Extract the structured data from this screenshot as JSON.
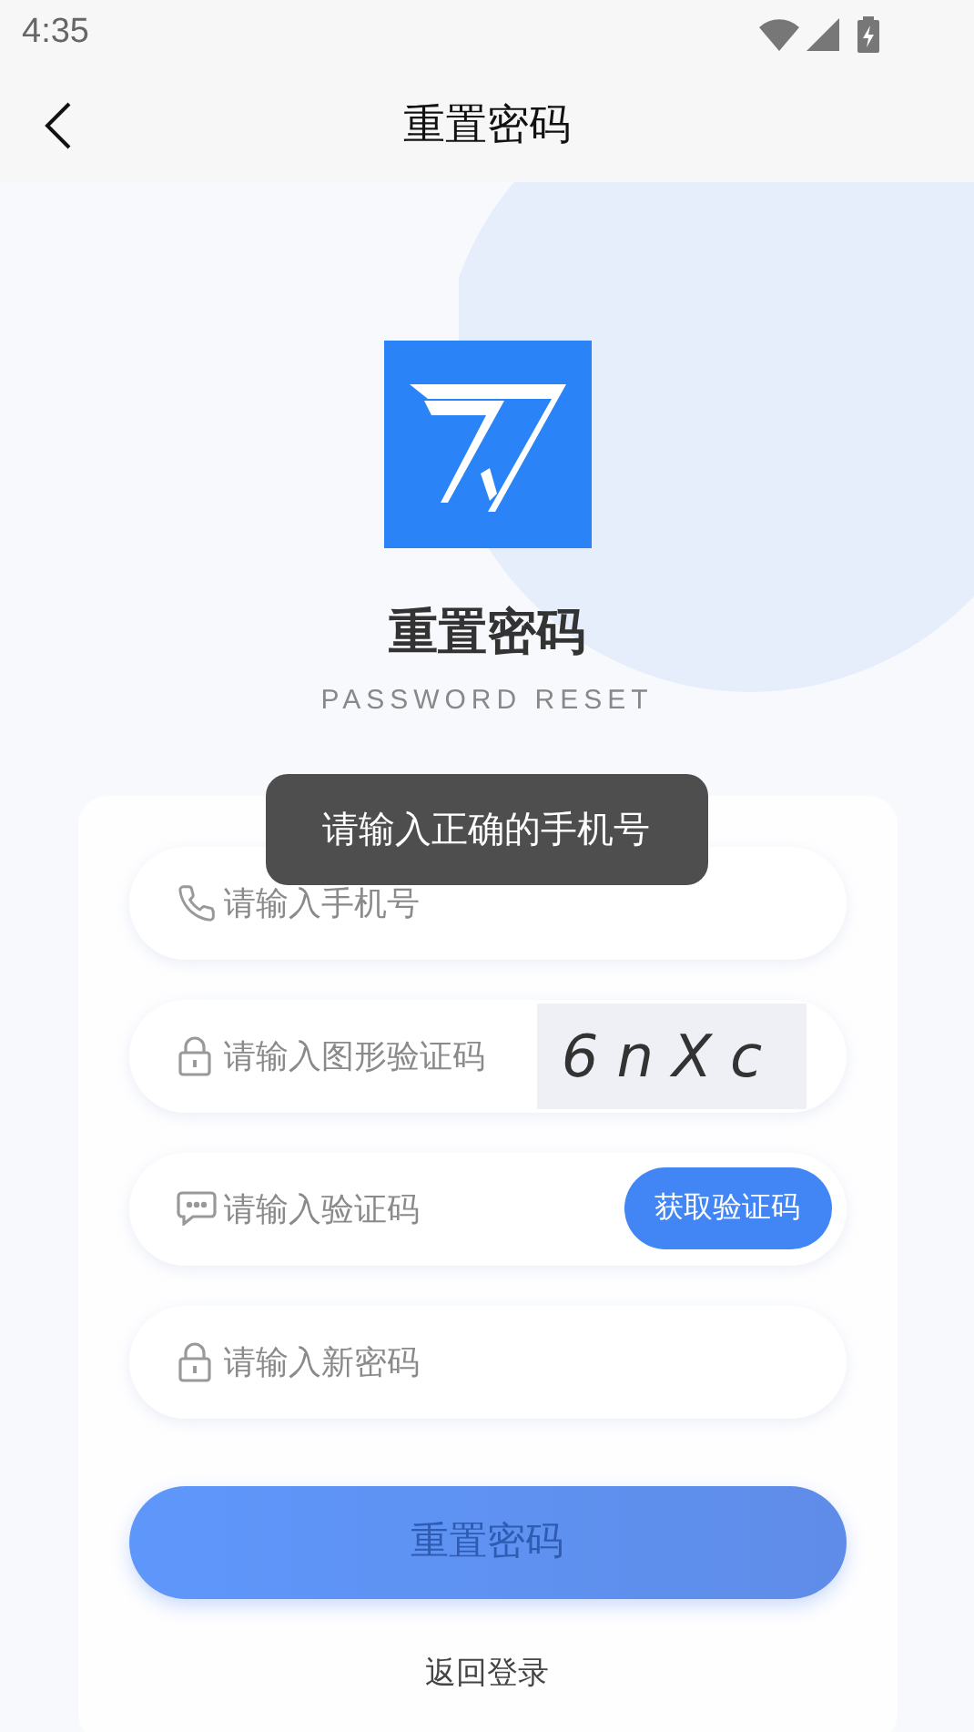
{
  "status_bar": {
    "time": "4:35"
  },
  "header": {
    "title": "重置密码"
  },
  "brand": {
    "title": "重置密码",
    "subtitle": "PASSWORD RESET"
  },
  "fields": [
    {
      "kind": "phone",
      "placeholder": "请输入手机号"
    },
    {
      "kind": "captcha",
      "placeholder": "请输入图形验证码",
      "captcha": "6nXc"
    },
    {
      "kind": "sms",
      "placeholder": "请输入验证码",
      "button": "获取验证码"
    },
    {
      "kind": "password",
      "placeholder": "请输入新密码"
    }
  ],
  "submit": {
    "label": "重置密码",
    "disabled": true
  },
  "back_link": "返回登录",
  "toast": "请输入正确的手机号"
}
